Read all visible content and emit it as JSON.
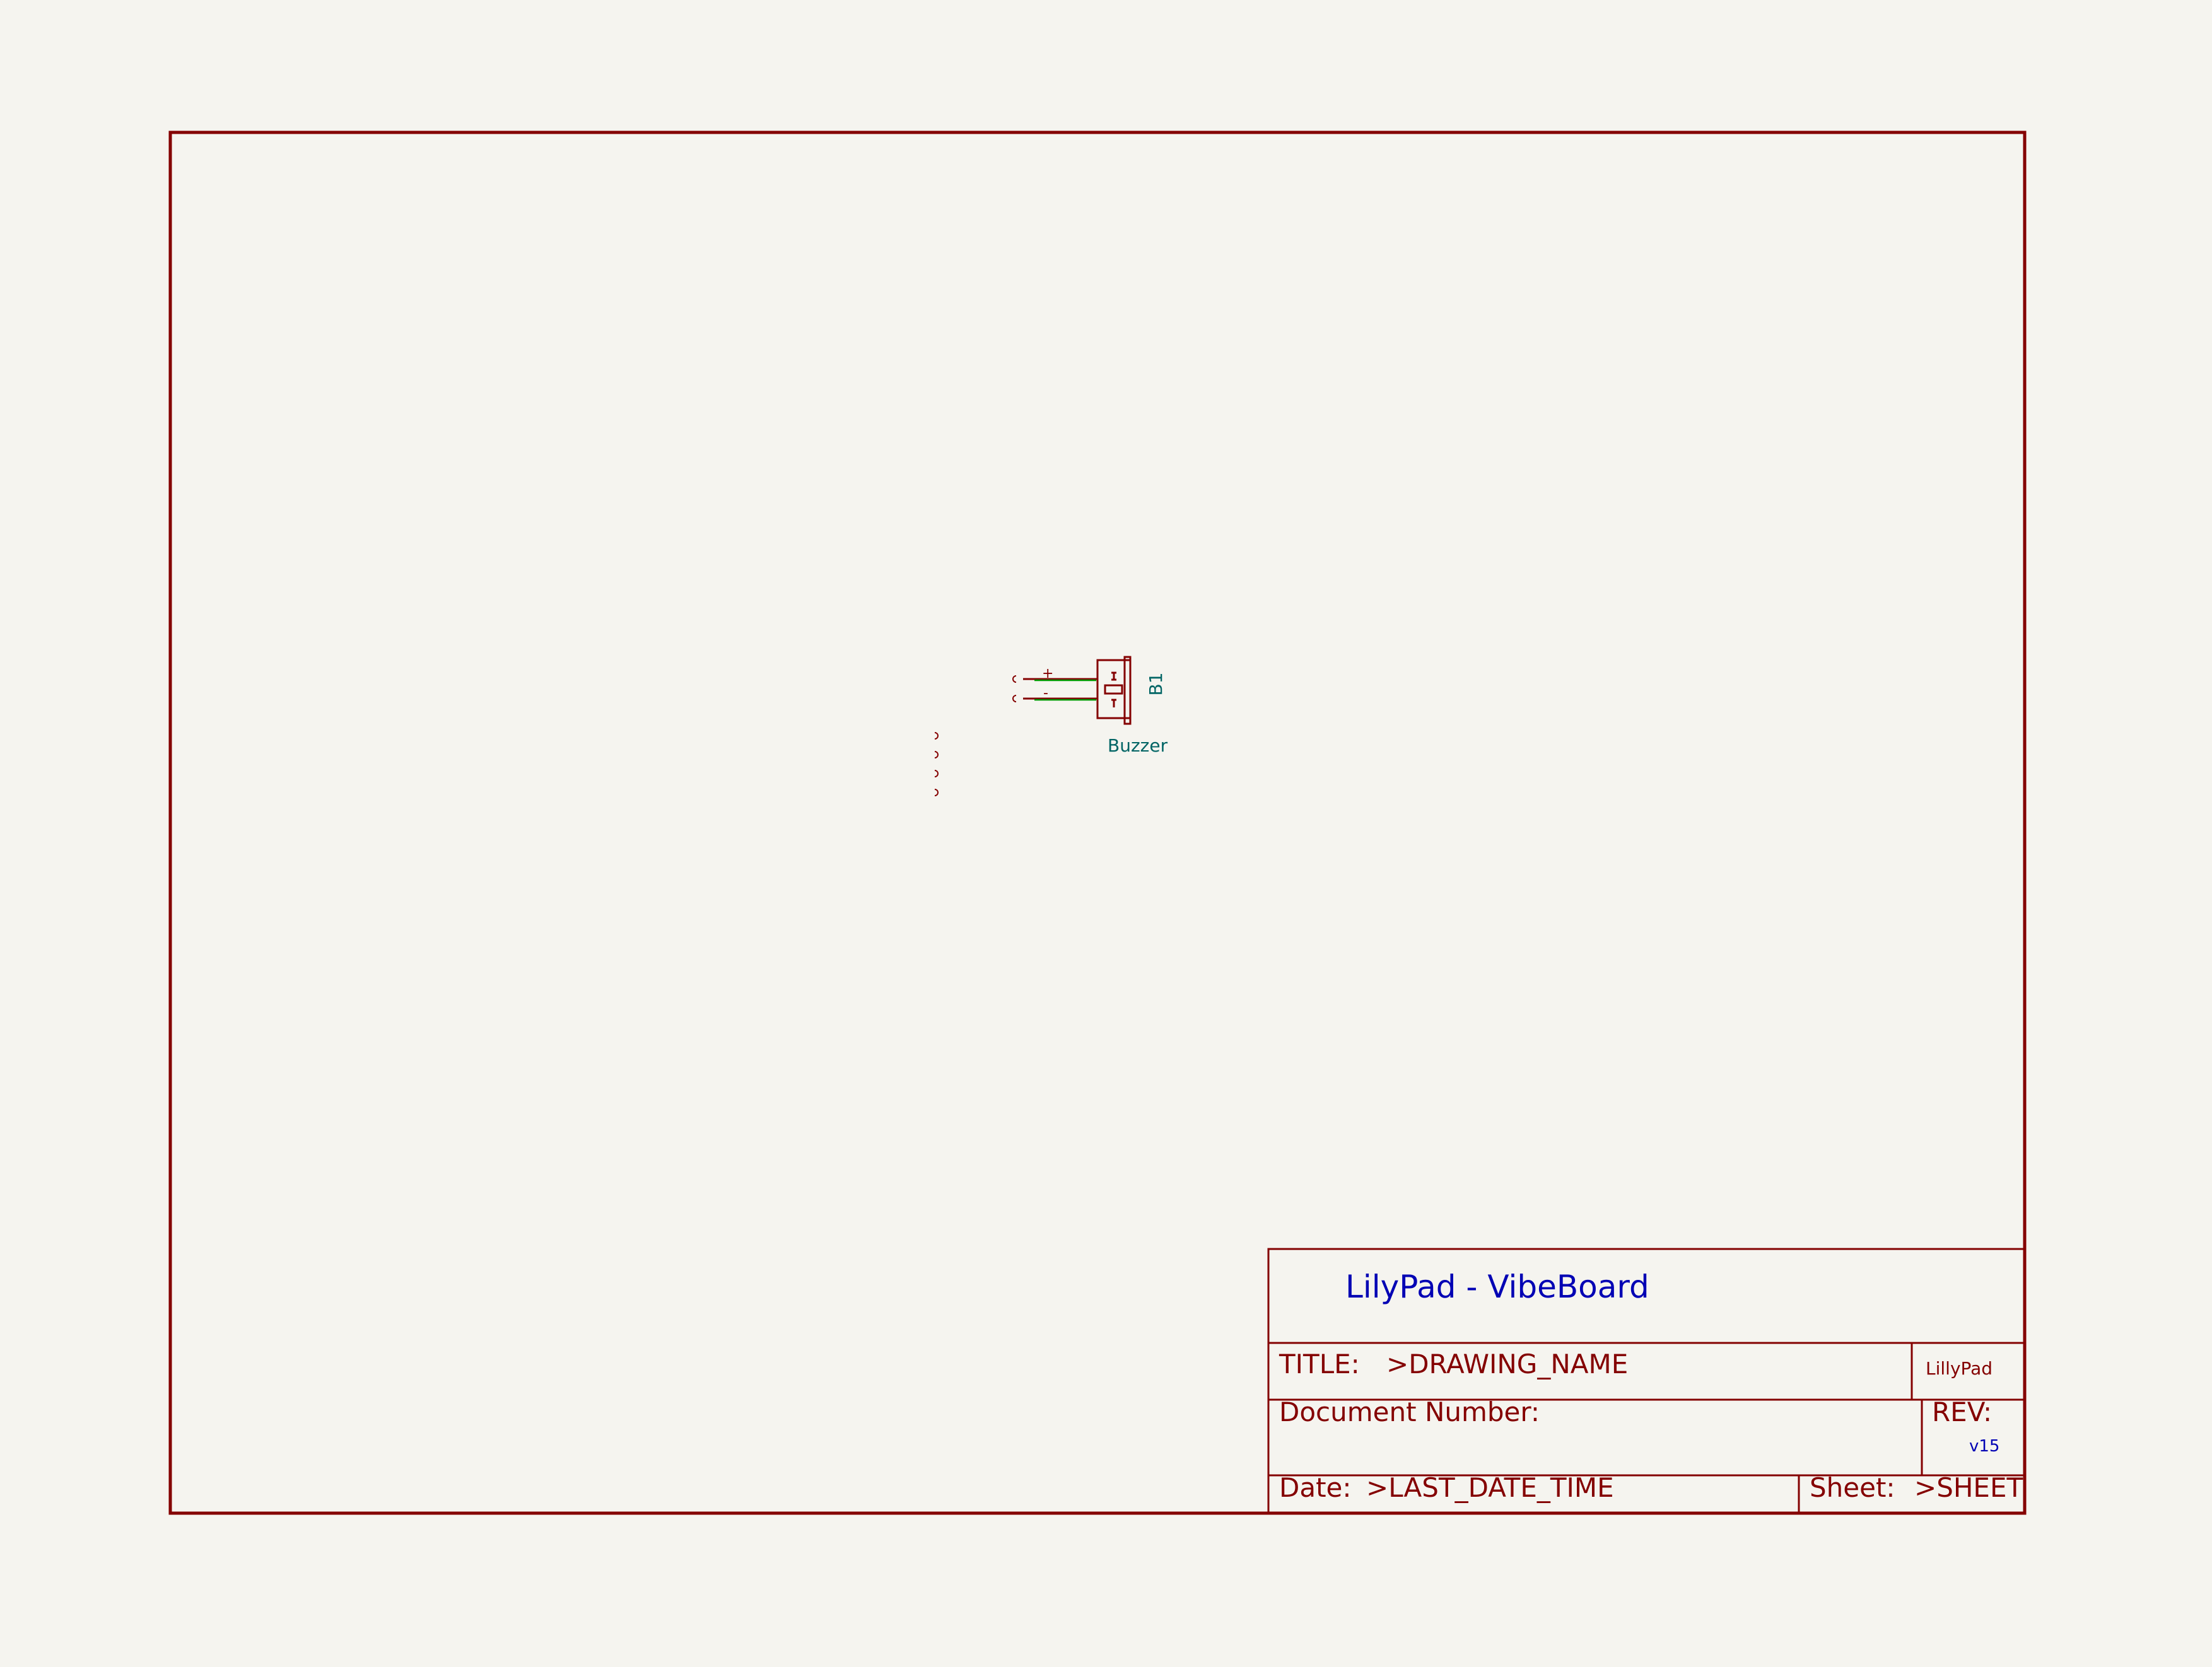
{
  "title_block": {
    "company": "LilyPad - VibeBoard",
    "title_label": "TITLE:",
    "title_value": ">DRAWING_NAME",
    "logo_text": "LillyPad",
    "document_number_label": "Document Number:",
    "rev_label": "REV:",
    "rev_value": "v15",
    "date_label": "Date:",
    "date_value": ">LAST_DATE_TIME",
    "sheet_label": "Sheet:",
    "sheet_value": ">SHEET"
  },
  "component": {
    "reference": "B1",
    "value": "Buzzer",
    "pin_plus": "+",
    "pin_minus": "-"
  },
  "colors": {
    "border": "#840000",
    "wire": "#009900",
    "title_text": "#0000b4",
    "component_text": "#006464",
    "background": "#f5f4ef"
  }
}
